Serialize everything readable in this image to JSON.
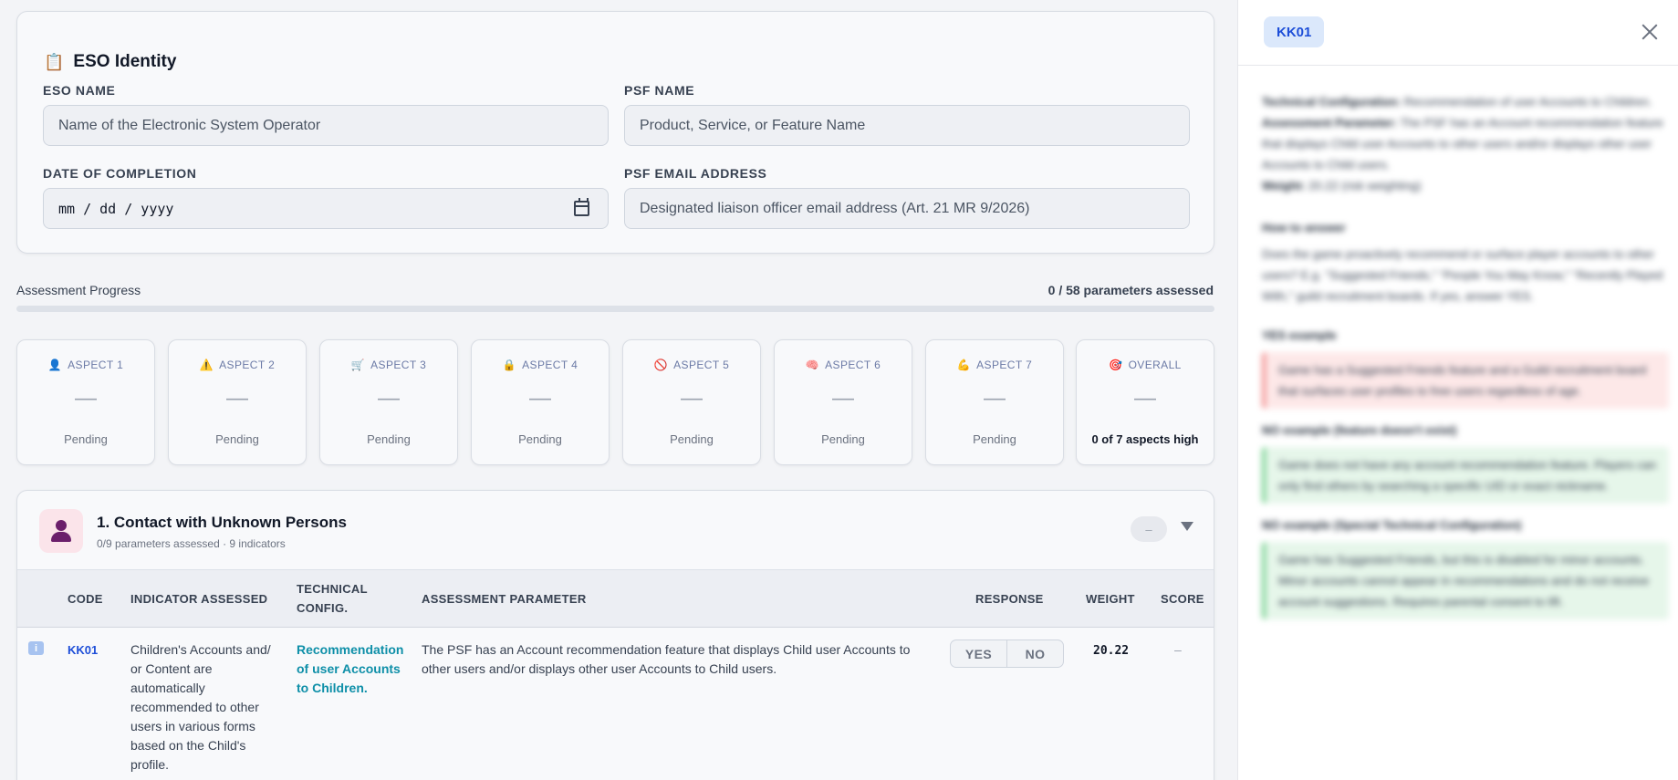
{
  "identity": {
    "title": "ESO Identity",
    "title_icon": "clipboard-icon",
    "eso_name_label": "ESO NAME",
    "eso_name_placeholder": "Name of the Electronic System Operator",
    "psf_name_label": "PSF NAME",
    "psf_name_placeholder": "Product, Service, or Feature Name",
    "date_label": "DATE OF COMPLETION",
    "date_value": "mm / dd / yyyy",
    "email_label": "PSF EMAIL ADDRESS",
    "email_placeholder": "Designated liaison officer email address (Art. 21 MR 9/2026)"
  },
  "progress": {
    "label": "Assessment Progress",
    "count_text": "0 / 58 parameters assessed",
    "fraction": 0
  },
  "aspects": [
    {
      "label": "ASPECT 1",
      "icon": "person-icon",
      "emoji": "👤",
      "value": "—",
      "status": "Pending"
    },
    {
      "label": "ASPECT 2",
      "icon": "warning-icon",
      "emoji": "⚠️",
      "value": "—",
      "status": "Pending"
    },
    {
      "label": "ASPECT 3",
      "icon": "cart-icon",
      "emoji": "🛒",
      "value": "—",
      "status": "Pending"
    },
    {
      "label": "ASPECT 4",
      "icon": "lock-icon",
      "emoji": "🔒",
      "value": "—",
      "status": "Pending"
    },
    {
      "label": "ASPECT 5",
      "icon": "no-entry-icon",
      "emoji": "🚫",
      "value": "—",
      "status": "Pending"
    },
    {
      "label": "ASPECT 6",
      "icon": "brain-icon",
      "emoji": "🧠",
      "value": "—",
      "status": "Pending"
    },
    {
      "label": "ASPECT 7",
      "icon": "flexed-arm-icon",
      "emoji": "💪",
      "value": "—",
      "status": "Pending"
    },
    {
      "label": "OVERALL",
      "icon": "target-icon",
      "emoji": "🎯",
      "value": "—",
      "status": "0 of 7 aspects high"
    }
  ],
  "section": {
    "title": "1. Contact with Unknown Persons",
    "subtitle": "0/9 parameters assessed · 9 indicators",
    "score_pill": "–",
    "columns": {
      "code": "CODE",
      "indicator": "INDICATOR ASSESSED",
      "tech": "TECHNICAL CONFIG.",
      "parameter": "ASSESSMENT PARAMETER",
      "response": "RESPONSE",
      "weight": "WEIGHT",
      "score": "SCORE"
    },
    "rows": [
      {
        "info_glyph": "i",
        "code": "KK01",
        "indicator": "Children's Accounts and/ or Content are automatically recommended to other users in various forms based on the Child's profile.",
        "tech": "Recommendation of user Accounts to Children.",
        "parameter": "The PSF has an Account recommendation feature that displays Child user Accounts to other users and/or displays other user Accounts to Child users.",
        "yes_label": "YES",
        "no_label": "NO",
        "weight": "20.22",
        "score": "–"
      }
    ]
  },
  "panel": {
    "code": "KK01",
    "tech_config_label": "Technical Configuration:",
    "tech_config_value": "Recommendation of user Accounts to Children.",
    "assessment_label": "Assessment Parameter:",
    "assessment_value": "The PSF has an Account recommendation feature that displays Child user Accounts to other users and/or displays other user Accounts to Child users.",
    "weight_label": "Weight:",
    "weight_value": "20.22 (risk weighting)",
    "how_title": "How to answer",
    "how_text": "Does the game proactively recommend or surface player accounts to other users? E.g. \"Suggested Friends,\" \"People You May Know,\" \"Recently Played With,\" guild recruitment boards. If yes, answer YES.",
    "yes_title": "YES example",
    "yes_text": "Game has a Suggested Friends feature and a Guild recruitment board that surfaces user profiles to free users regardless of age.",
    "no_title": "NO example (feature doesn't exist)",
    "no_text": "Game does not have any account recommendation feature. Players can only find others by searching a specific UID or exact nickname.",
    "no2_title": "NO example (Special Technical Configuration)",
    "no2_text": "Game has Suggested Friends, but this is disabled for minor accounts. Minor accounts cannot appear in recommendations and do not receive account suggestions. Requires parental consent to lift."
  }
}
